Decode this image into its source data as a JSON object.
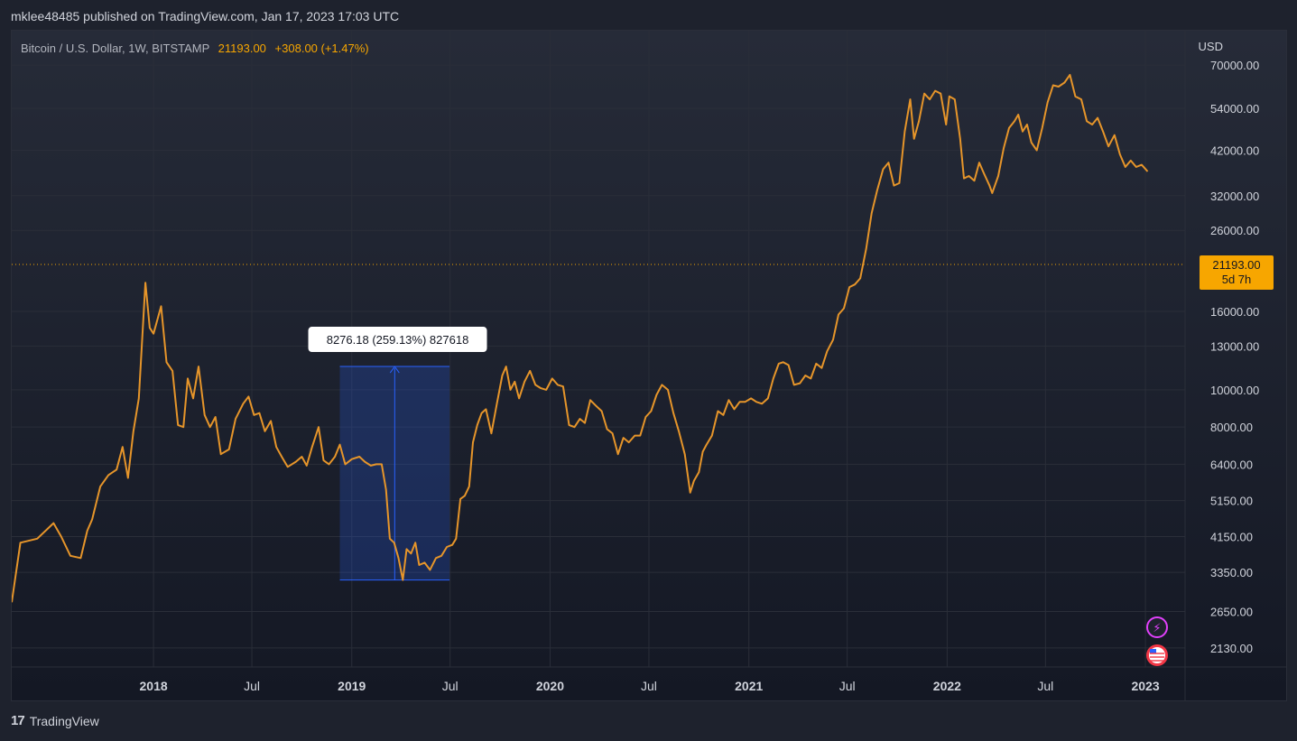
{
  "header": {
    "published_text": "mklee48485 published on TradingView.com, Jan 17, 2023 17:03 UTC"
  },
  "legend": {
    "symbol": "Bitcoin / U.S. Dollar, 1W, BITSTAMP",
    "price": "21193.00",
    "change": "+308.00 (+1.47%)"
  },
  "currency": "USD",
  "last_price_tag": {
    "price": "21193.00",
    "countdown": "5d 7h"
  },
  "measure_label": "8276.18 (259.13%) 827618",
  "footer": {
    "brand": "TradingView"
  },
  "colors": {
    "line": "#e6952a",
    "accent": "#f7a600",
    "measure": "#2962ff",
    "grid": "#2a2e39"
  },
  "icons": [
    "lightning-icon",
    "us-flag-icon"
  ],
  "chart_data": {
    "type": "line",
    "title": "Bitcoin / U.S. Dollar, 1W, BITSTAMP",
    "scale": "log",
    "ylim": [
      1900,
      86000
    ],
    "yticks": [
      "70000.00",
      "54000.00",
      "42000.00",
      "32000.00",
      "26000.00",
      "16000.00",
      "13000.00",
      "10000.00",
      "8000.00",
      "6400.00",
      "5150.00",
      "4150.00",
      "3350.00",
      "2650.00",
      "2130.00"
    ],
    "xticks": [
      {
        "label": "2018",
        "date": "2018-01-01",
        "bold": true
      },
      {
        "label": "Jul",
        "date": "2018-07-01",
        "bold": false
      },
      {
        "label": "2019",
        "date": "2019-01-01",
        "bold": true
      },
      {
        "label": "Jul",
        "date": "2019-07-01",
        "bold": false
      },
      {
        "label": "2020",
        "date": "2020-01-01",
        "bold": true
      },
      {
        "label": "Jul",
        "date": "2020-07-01",
        "bold": false
      },
      {
        "label": "2021",
        "date": "2021-01-01",
        "bold": true
      },
      {
        "label": "Jul",
        "date": "2021-07-01",
        "bold": false
      },
      {
        "label": "2022",
        "date": "2022-01-01",
        "bold": true
      },
      {
        "label": "Jul",
        "date": "2022-07-01",
        "bold": false
      },
      {
        "label": "2023",
        "date": "2023-01-01",
        "bold": true
      }
    ],
    "xlim": [
      "2017-04-15",
      "2023-03-15"
    ],
    "last_value": 21193,
    "measure": {
      "from_date": "2018-12-10",
      "to_date": "2019-06-30",
      "low": 3200,
      "high": 11500
    },
    "series": [
      {
        "points": [
          [
            "2017-04-15",
            2800
          ],
          [
            "2017-05-01",
            4000
          ],
          [
            "2017-06-01",
            4100
          ],
          [
            "2017-07-01",
            4500
          ],
          [
            "2017-07-15",
            4150
          ],
          [
            "2017-08-01",
            3700
          ],
          [
            "2017-08-20",
            3650
          ],
          [
            "2017-09-01",
            4300
          ],
          [
            "2017-09-10",
            4600
          ],
          [
            "2017-09-25",
            5600
          ],
          [
            "2017-10-10",
            6000
          ],
          [
            "2017-10-25",
            6200
          ],
          [
            "2017-11-05",
            7100
          ],
          [
            "2017-11-15",
            5900
          ],
          [
            "2017-11-25",
            7800
          ],
          [
            "2017-12-05",
            9500
          ],
          [
            "2017-12-17",
            19000
          ],
          [
            "2017-12-25",
            14500
          ],
          [
            "2018-01-01",
            14000
          ],
          [
            "2018-01-15",
            16500
          ],
          [
            "2018-01-25",
            11800
          ],
          [
            "2018-02-05",
            11200
          ],
          [
            "2018-02-15",
            8100
          ],
          [
            "2018-02-25",
            8000
          ],
          [
            "2018-03-05",
            10700
          ],
          [
            "2018-03-15",
            9500
          ],
          [
            "2018-03-25",
            11500
          ],
          [
            "2018-04-05",
            8600
          ],
          [
            "2018-04-15",
            8000
          ],
          [
            "2018-04-25",
            8500
          ],
          [
            "2018-05-05",
            6800
          ],
          [
            "2018-05-20",
            7000
          ],
          [
            "2018-06-01",
            8400
          ],
          [
            "2018-06-15",
            9200
          ],
          [
            "2018-06-25",
            9600
          ],
          [
            "2018-07-05",
            8600
          ],
          [
            "2018-07-15",
            8700
          ],
          [
            "2018-07-25",
            7800
          ],
          [
            "2018-08-05",
            8300
          ],
          [
            "2018-08-15",
            7100
          ],
          [
            "2018-08-25",
            6700
          ],
          [
            "2018-09-05",
            6300
          ],
          [
            "2018-09-20",
            6500
          ],
          [
            "2018-10-01",
            6700
          ],
          [
            "2018-10-10",
            6350
          ],
          [
            "2018-10-20",
            7100
          ],
          [
            "2018-11-01",
            8000
          ],
          [
            "2018-11-10",
            6550
          ],
          [
            "2018-11-20",
            6400
          ],
          [
            "2018-12-01",
            6700
          ],
          [
            "2018-12-10",
            7200
          ],
          [
            "2018-12-20",
            6400
          ],
          [
            "2019-01-01",
            6600
          ],
          [
            "2019-01-15",
            6700
          ],
          [
            "2019-01-25",
            6500
          ],
          [
            "2019-02-05",
            6350
          ],
          [
            "2019-02-15",
            6400
          ],
          [
            "2019-02-25",
            6400
          ],
          [
            "2019-03-05",
            5500
          ],
          [
            "2019-03-12",
            4100
          ],
          [
            "2019-03-20",
            4000
          ],
          [
            "2019-03-28",
            3650
          ],
          [
            "2019-04-05",
            3200
          ],
          [
            "2019-04-12",
            3850
          ],
          [
            "2019-04-20",
            3750
          ],
          [
            "2019-04-28",
            4000
          ],
          [
            "2019-05-05",
            3500
          ],
          [
            "2019-05-15",
            3550
          ],
          [
            "2019-05-25",
            3400
          ],
          [
            "2019-06-05",
            3650
          ],
          [
            "2019-06-15",
            3700
          ],
          [
            "2019-06-25",
            3900
          ],
          [
            "2019-07-05",
            3950
          ],
          [
            "2019-07-12",
            4100
          ],
          [
            "2019-07-20",
            5200
          ],
          [
            "2019-07-28",
            5300
          ],
          [
            "2019-08-05",
            5600
          ],
          [
            "2019-08-12",
            7300
          ],
          [
            "2019-08-20",
            8100
          ],
          [
            "2019-08-28",
            8700
          ],
          [
            "2019-09-05",
            8900
          ],
          [
            "2019-09-15",
            7700
          ],
          [
            "2019-09-25",
            9200
          ],
          [
            "2019-10-05",
            10900
          ],
          [
            "2019-10-12",
            11500
          ],
          [
            "2019-10-20",
            10000
          ],
          [
            "2019-10-28",
            10500
          ],
          [
            "2019-11-05",
            9500
          ],
          [
            "2019-11-15",
            10500
          ],
          [
            "2019-11-25",
            11200
          ],
          [
            "2019-12-05",
            10300
          ],
          [
            "2019-12-15",
            10100
          ],
          [
            "2019-12-25",
            10000
          ],
          [
            "2020-01-05",
            10700
          ],
          [
            "2020-01-15",
            10300
          ],
          [
            "2020-01-25",
            10200
          ],
          [
            "2020-02-05",
            8100
          ],
          [
            "2020-02-15",
            8000
          ],
          [
            "2020-02-25",
            8400
          ],
          [
            "2020-03-05",
            8200
          ],
          [
            "2020-03-15",
            9400
          ],
          [
            "2020-03-25",
            9100
          ],
          [
            "2020-04-05",
            8800
          ],
          [
            "2020-04-15",
            7900
          ],
          [
            "2020-04-25",
            7700
          ],
          [
            "2020-05-05",
            6800
          ],
          [
            "2020-05-15",
            7500
          ],
          [
            "2020-05-25",
            7300
          ],
          [
            "2020-06-05",
            7600
          ],
          [
            "2020-06-15",
            7600
          ],
          [
            "2020-06-25",
            8500
          ],
          [
            "2020-07-05",
            8800
          ],
          [
            "2020-07-15",
            9700
          ],
          [
            "2020-07-25",
            10300
          ],
          [
            "2020-08-05",
            10000
          ],
          [
            "2020-08-15",
            8700
          ],
          [
            "2020-08-25",
            7800
          ],
          [
            "2020-09-05",
            6800
          ],
          [
            "2020-09-15",
            5400
          ],
          [
            "2020-09-22",
            5800
          ],
          [
            "2020-10-01",
            6100
          ],
          [
            "2020-10-08",
            6900
          ],
          [
            "2020-10-15",
            7200
          ],
          [
            "2020-10-25",
            7600
          ],
          [
            "2020-11-05",
            8800
          ],
          [
            "2020-11-15",
            8600
          ],
          [
            "2020-11-25",
            9400
          ],
          [
            "2020-12-05",
            8900
          ],
          [
            "2020-12-15",
            9300
          ],
          [
            "2020-12-25",
            9300
          ],
          [
            "2021-01-05",
            9500
          ],
          [
            "2021-01-15",
            9300
          ],
          [
            "2021-01-25",
            9200
          ],
          [
            "2021-02-05",
            9500
          ],
          [
            "2021-02-15",
            10700
          ],
          [
            "2021-02-25",
            11700
          ],
          [
            "2021-03-05",
            11800
          ],
          [
            "2021-03-15",
            11600
          ],
          [
            "2021-03-25",
            10300
          ],
          [
            "2021-04-05",
            10400
          ],
          [
            "2021-04-15",
            10900
          ],
          [
            "2021-04-25",
            10700
          ],
          [
            "2021-05-05",
            11700
          ],
          [
            "2021-05-15",
            11400
          ],
          [
            "2021-05-25",
            12600
          ],
          [
            "2021-06-05",
            13500
          ],
          [
            "2021-06-15",
            15700
          ],
          [
            "2021-06-25",
            16300
          ],
          [
            "2021-07-05",
            18500
          ],
          [
            "2021-07-15",
            18800
          ],
          [
            "2021-07-25",
            19500
          ],
          [
            "2021-08-05",
            23300
          ],
          [
            "2021-08-15",
            28800
          ],
          [
            "2021-08-25",
            33000
          ],
          [
            "2021-09-05",
            37500
          ],
          [
            "2021-09-15",
            39000
          ],
          [
            "2021-09-25",
            34000
          ],
          [
            "2021-10-05",
            34500
          ],
          [
            "2021-10-15",
            47000
          ],
          [
            "2021-10-25",
            57000
          ],
          [
            "2021-11-01",
            45000
          ],
          [
            "2021-11-10",
            50000
          ],
          [
            "2021-11-20",
            59000
          ],
          [
            "2021-11-30",
            57000
          ],
          [
            "2021-12-10",
            60000
          ],
          [
            "2021-12-20",
            59000
          ],
          [
            "2021-12-30",
            49000
          ],
          [
            "2022-01-05",
            58000
          ],
          [
            "2022-01-15",
            57000
          ],
          [
            "2022-01-25",
            45000
          ],
          [
            "2022-02-01",
            35500
          ],
          [
            "2022-02-10",
            36000
          ],
          [
            "2022-02-20",
            35000
          ],
          [
            "2022-03-01",
            39000
          ],
          [
            "2022-03-10",
            36500
          ],
          [
            "2022-03-20",
            34000
          ],
          [
            "2022-03-25",
            32500
          ],
          [
            "2022-04-05",
            36000
          ],
          [
            "2022-04-15",
            42500
          ],
          [
            "2022-04-25",
            48000
          ],
          [
            "2022-05-05",
            50000
          ],
          [
            "2022-05-12",
            52000
          ],
          [
            "2022-05-20",
            47000
          ],
          [
            "2022-05-28",
            49000
          ],
          [
            "2022-06-05",
            44000
          ],
          [
            "2022-06-15",
            42000
          ],
          [
            "2022-06-25",
            48000
          ],
          [
            "2022-07-05",
            56000
          ],
          [
            "2022-07-15",
            62000
          ],
          [
            "2022-07-25",
            61500
          ],
          [
            "2022-08-05",
            63000
          ],
          [
            "2022-08-15",
            66000
          ],
          [
            "2022-08-25",
            58000
          ],
          [
            "2022-09-05",
            57000
          ],
          [
            "2022-09-15",
            50000
          ],
          [
            "2022-09-25",
            49000
          ],
          [
            "2022-10-05",
            51000
          ],
          [
            "2022-10-15",
            47000
          ],
          [
            "2022-10-25",
            43000
          ],
          [
            "2022-11-05",
            46000
          ],
          [
            "2022-11-15",
            41000
          ],
          [
            "2022-11-25",
            38000
          ],
          [
            "2022-12-05",
            39500
          ],
          [
            "2022-12-15",
            38000
          ],
          [
            "2022-12-25",
            38500
          ],
          [
            "2023-01-05",
            37000
          ]
        ]
      }
    ]
  }
}
